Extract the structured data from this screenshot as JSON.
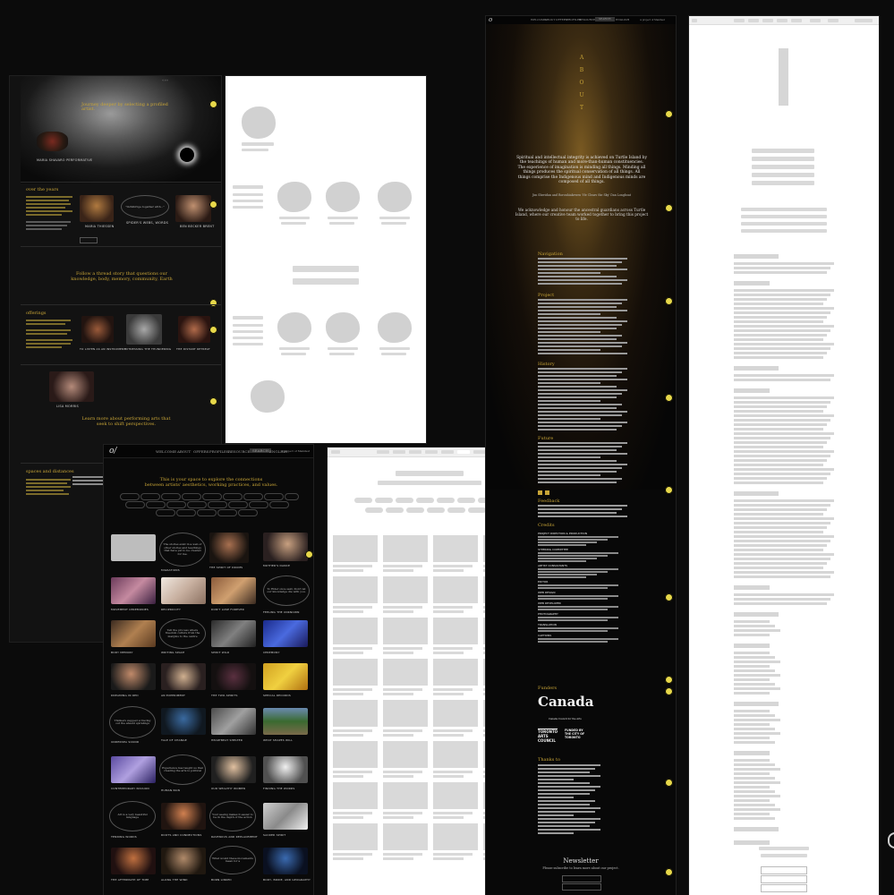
{
  "artboard_left": {
    "journey_text": "Journey deeper by selecting a profiled artist.",
    "over_years_heading": "over the years",
    "follow_text": "Follow a thread story that questions our knowledge, body, memory, community, Earth",
    "offerings_heading": "offerings",
    "learn_text": "Learn more about performing arts that seek to shift perspectives.",
    "spaces_heading": "spaces and distances",
    "artist_captions": [
      "MARIA THIESSEN",
      "SPIDER'S WEBS, WORDS",
      "BEN BECKER BRENT"
    ],
    "offering_captions": [
      "TO LISTEN AS AN INSTRUMENT",
      "WITNESSING THE THUNDERING",
      "THE DISTANT RETREAT"
    ],
    "lone_caption": "LISA MORRIS",
    "top_label": "MARIA SHAVARO PERFORMATIVE"
  },
  "artboard_center": {
    "nav": [
      "WELCOME",
      "ABOUT",
      "OFFERS",
      "PROFILES",
      "RESOURCES"
    ],
    "search": "SEARCH",
    "lang": "ENGLISH",
    "byline": "A project of Manifest",
    "intro_line1": "This is your space to explore the connections",
    "intro_line2": "between artists' aesthetics, working practices, and values.",
    "tags_row1": [
      "ALL",
      "ACCESSIBILITY",
      "BODY",
      "CREATIVE",
      "DANCE",
      "DEFINE",
      "EMERGING",
      "FEMINISM",
      "HEALING"
    ],
    "tags_row2": [
      "IDENTITY",
      "JOURNEY",
      "LAND",
      "LANGUAGE",
      "MEMORY",
      "QUEER",
      "RITUAL",
      "SPIRIT",
      "TRAUMA"
    ],
    "tags_row3": [
      "COMMUNITY",
      "CULTURE",
      "DECOLONIZE",
      "EARTH",
      "ALL"
    ],
    "quotes": [
      "The stories exist in a web of other stories and teachings that have yet to be created for me.",
      "To Elder once said, Don't let our knowledge die with you.",
      "Tell the process where freedom culture from the margins to the centre",
      "Thinkers suggest a tracing out the absent spiralings",
      "Experience has taught us that creating the arts is political",
      "Art is a very beautiful language",
      "Your seeing makes it easier to be in the depth of the action",
      "What would these movements mean for a"
    ],
    "captions": [
      "MIGRATIONS",
      "THE SPIRIT OF DRUMS",
      "MOTHER'S DANCE",
      "MOVEMENT CEREMONIES",
      "RECIPROCITY",
      "DON'T LOSE FOREVER",
      "FEELING THE UNKNOWN",
      "BODY MEMORY",
      "WRITING SPACE",
      "SPIRIT WILD",
      "CEREMONY",
      "DREAMING IN RED",
      "AN EXPERIMENT",
      "THE TWO-SPIRITS",
      "SPECIAL RECORDS",
      "UNDERSEA SOUND",
      "TALE OF CHANGE",
      "HEARTBEAT SHELTER",
      "WHAT SHAPES WILL",
      "CONTEMPORARY PASSION",
      "HUMAN PAIN",
      "OUR WEALTHY WOMEN",
      "FINDING THE WORDS",
      "TENDING WORDS",
      "ROOTS AND CONNECTIONS",
      "RAVENOUS AND REPLACEMENT",
      "SACRED SPIRIT",
      "THE AFTERMATH OF TIME",
      "ALONG THE WIND",
      "BORN LINKED",
      "BODY, BRIDE, AND GEOGRAPHY"
    ]
  },
  "artboard_about": {
    "vertical_title": [
      "A",
      "B",
      "O",
      "U",
      "T"
    ],
    "quote": "Spiritual and intellectual integrity is achieved on Turtle Island by the teachings of human and more-than-human constituencies. The experience of imagination is minding all things. Minding all things produces the spiritual conservation of all things. All things comprise the Indigenous mind and Indigenous minds are composed of all things.",
    "quote_attribution": "Jim Sheridan and Roronhiakewen 'He Clears the Sky' Dan Longboat",
    "acknowledge": "We acknowledge and honour the ancestral guardians across Turtle Island, where our creative team worked together to bring this project to life.",
    "sections": [
      "Navigation",
      "Project",
      "History",
      "Future",
      "Feedback",
      "Credits",
      "Funders",
      "Thanks to"
    ],
    "funders": [
      "Canada",
      "Canada Council for the Arts",
      "TORONTO ARTS COUNCIL",
      "FUNDED BY THE CITY OF TORONTO"
    ],
    "credit_headings": [
      "PROJECT DIRECTION & PRODUCTION",
      "STEERING COMMITTEE",
      "ARTIST CONSULTANTS",
      "EDITOR",
      "WEB DESIGN",
      "WEB DEVELOPER",
      "PHOTOGRAPHY",
      "TRANSLATION",
      "CAPTIONS"
    ]
  },
  "artboard_right": {
    "newsletter_title": "Newsletter",
    "newsletter_sub": "Please subscribe to learn more about our project."
  },
  "colors": {
    "background": "#0b0b0b",
    "dark_panel": "#121212",
    "accent_gold": "#c7a437",
    "indicator_yellow": "#e7d84a",
    "wireframe_bg": "#ffffff",
    "wireframe_block": "#d6d6d6"
  }
}
